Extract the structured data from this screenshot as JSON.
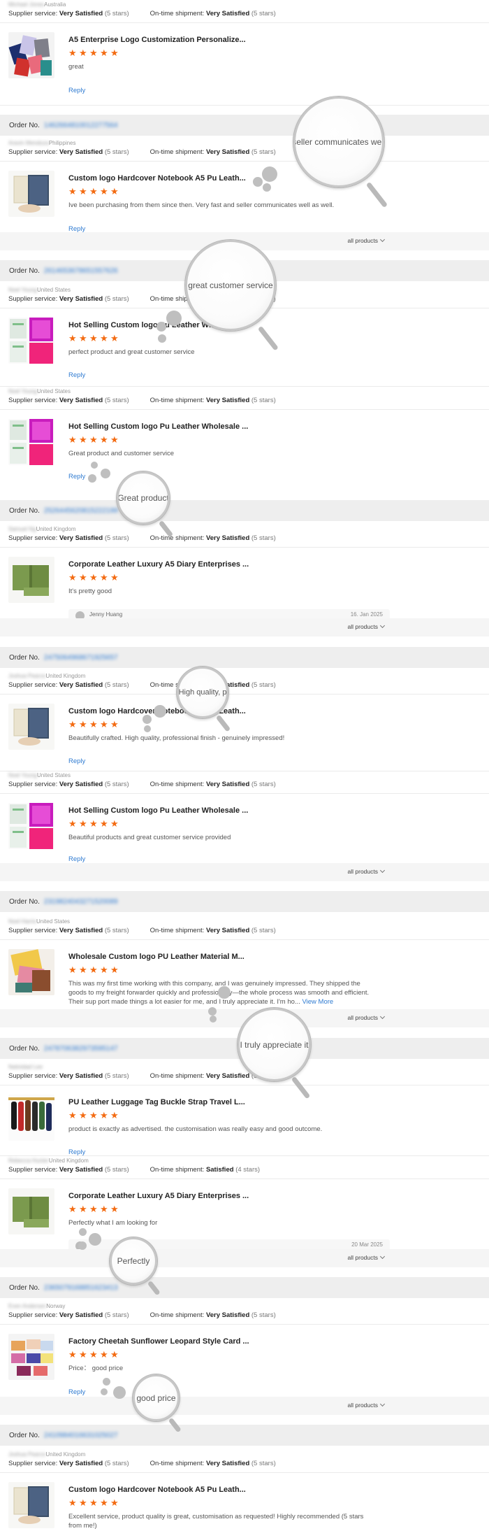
{
  "labels": {
    "order": "Order No.",
    "supplier": "Supplier service:",
    "ontime": "On-time shipment:",
    "reply": "Reply",
    "all_products": "all products",
    "view_more": "View More"
  },
  "colors": {
    "star": "#f36b12",
    "link": "#2f7bd1",
    "order_bar": "#eeeeee"
  },
  "r0": {
    "name": "Michael Jones",
    "country": "Australia",
    "s_val": "Very Satisfied",
    "s_stars": "(5 stars)",
    "o_val": "Very Satisfied",
    "o_stars": "(5 stars)",
    "title": "A5 Enterprise Logo Customization Personalize...",
    "rating": 5,
    "text": "great"
  },
  "o1": {
    "number": "1462664810012277564"
  },
  "r1": {
    "name": "Aravin Mendoza",
    "country": "Philippines",
    "s_val": "Very Satisfied",
    "s_stars": "(5 stars)",
    "o_val": "Very Satisfied",
    "o_stars": "(5 stars)",
    "title": "Custom logo Hardcover Notebook A5 Pu Leath...",
    "rating": 5,
    "text": "Ive been purchasing from them since then. Very fast and seller communicates well as well."
  },
  "o2": {
    "number": "2614653678651557626"
  },
  "r2": {
    "name": "Noel Young",
    "country": "United States",
    "s_val": "Very Satisfied",
    "s_stars": "(5 stars)",
    "o_val": "Very Satisfied",
    "o_stars": "(5 stars)",
    "title": "Hot Selling Custom logo Pu Leather Wholesale ...",
    "rating": 5,
    "text": "perfect product and great customer service"
  },
  "r3": {
    "name": "Noel Young",
    "country": "United States",
    "s_val": "Very Satisfied",
    "s_stars": "(5 stars)",
    "o_val": "Very Satisfied",
    "o_stars": "(5 stars)",
    "title": "Hot Selling Custom logo Pu Leather Wholesale ...",
    "rating": 5,
    "text": "Great product and customer service"
  },
  "o3": {
    "number": "2526445620815222199"
  },
  "r4": {
    "name": "Samuel Ng",
    "country": "United Kingdom",
    "s_val": "Very Satisfied",
    "s_stars": "(5 stars)",
    "o_val": "Very Satisfied",
    "o_stars": "(5 stars)",
    "title": "Corporate Leather Luxury A5 Diary Enterprises ...",
    "rating": 5,
    "text": "It's pretty good",
    "sub_name": "Jenny Huang",
    "sub_date": "16. Jan 2025"
  },
  "o4": {
    "number": "2475064968671925657"
  },
  "r5": {
    "name": "Joshua Pearce",
    "country": "United Kingdom",
    "s_val": "Very Satisfied",
    "s_stars": "(5 stars)",
    "o_val": "Very Satisfied",
    "o_stars": "(5 stars)",
    "title": "Custom logo Hardcover Notebook A5 Pu Leath...",
    "rating": 5,
    "text": "Beautifully crafted. High quality, professional finish - genuinely impressed!"
  },
  "r6": {
    "name": "Noel Young",
    "country": "United States",
    "s_val": "Very Satisfied",
    "s_stars": "(5 stars)",
    "o_val": "Very Satisfied",
    "o_stars": "(5 stars)",
    "title": "Hot Selling Custom logo Pu Leather Wholesale ...",
    "rating": 5,
    "text": "Beautiful products and great customer service provided"
  },
  "o5": {
    "number": "2319824043271520089"
  },
  "r7": {
    "name": "Noel Harris",
    "country": "United States",
    "s_val": "Very Satisfied",
    "s_stars": "(5 stars)",
    "o_val": "Very Satisfied",
    "o_stars": "(5 stars)",
    "title": "Wholesale Custom logo PU Leather Material M...",
    "rating": 5,
    "text": "This was my first time working with this company, and I was genuinely impressed. They shipped the goods to my freight forwarder quickly and professionally—the whole process was smooth and efficient. Their sup port made things a lot easier for me, and I truly appreciate it. I'm ho..."
  },
  "o6": {
    "number": "2478706382973595147"
  },
  "r8": {
    "name": "Natividad Lee",
    "country": "",
    "s_val": "Very Satisfied",
    "s_stars": "(5 stars)",
    "o_val": "Very Satisfied",
    "o_stars": "(5 stars)",
    "title": "PU Leather Luggage Tag Buckle Strap Travel L...",
    "rating": 5,
    "text": "product is exactly as advertised. the customisation was really easy and good outcome."
  },
  "r9": {
    "name": "Rebecca Hunter",
    "country": "United Kingdom",
    "s_val": "Very Satisfied",
    "s_stars": "(5 stars)",
    "o_val": "Satisfied",
    "o_stars": "(4 stars)",
    "title": "Corporate Leather Luxury A5 Diary Enterprises ...",
    "rating": 5,
    "text": "Perfectly what I am looking for",
    "sub_date": "20 Mar 2025"
  },
  "o7": {
    "number": "2365079168851623413"
  },
  "r10": {
    "name": "Even Andersen",
    "country": "Norway",
    "s_val": "Very Satisfied",
    "s_stars": "(5 stars)",
    "o_val": "Very Satisfied",
    "o_stars": "(5 stars)",
    "title": "Factory Cheetah Sunflower Leopard Style Card ...",
    "rating": 5,
    "text": "Price： good price"
  },
  "o8": {
    "number": "2410984016631025027"
  },
  "r11": {
    "name": "Joshua Pearce",
    "country": "United Kingdom",
    "s_val": "Very Satisfied",
    "s_stars": "(5 stars)",
    "o_val": "Very Satisfied",
    "o_stars": "(5 stars)",
    "title": "Custom logo Hardcover Notebook A5 Pu Leath...",
    "rating": 5,
    "text": "Excellent service, product quality is great, customisation as requested! Highly recommended (5 stars from me!)"
  },
  "magnifiers": [
    {
      "text": "seller communicates well"
    },
    {
      "text": "great customer service"
    },
    {
      "text": "Great product"
    },
    {
      "text": "High quality, p"
    },
    {
      "text": "I truly appreciate it"
    },
    {
      "text": "Perfectly"
    },
    {
      "text": "good price"
    }
  ]
}
